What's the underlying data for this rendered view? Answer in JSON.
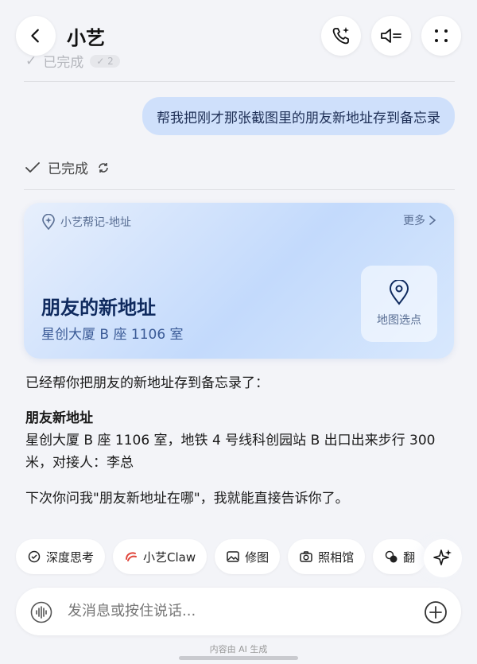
{
  "header": {
    "title": "小艺",
    "back_icon": "chevron-left-icon",
    "actions": [
      "phone-sparkle-icon",
      "speaker-icon",
      "more-dots-icon"
    ]
  },
  "previous_status": {
    "label": "已完成",
    "badge": "✓ 2"
  },
  "user_message": "帮我把刚才那张截图里的朋友新地址存到备忘录",
  "status": {
    "label": "已完成"
  },
  "card": {
    "source": "小艺帮记-地址",
    "more": "更多",
    "title": "朋友的新地址",
    "subtitle": "星创大厦 B 座 1106 室",
    "map_button": "地图选点"
  },
  "reply": {
    "intro": "已经帮你把朋友的新地址存到备忘录了：",
    "heading": "朋友新地址",
    "body_line1": "星创大厦 B 座 1106 室，地铁 4 号线科创园站 B 出口出来步行 300",
    "body_line2": "米，对接人：李总",
    "closing": "下次你问我\"朋友新地址在哪\"，我就能直接告诉你了。"
  },
  "chips": [
    {
      "label": "深度思考",
      "icon": "deep-think-icon"
    },
    {
      "label": "小艺Claw",
      "icon": "claw-icon"
    },
    {
      "label": "修图",
      "icon": "image-edit-icon"
    },
    {
      "label": "照相馆",
      "icon": "camera-icon"
    },
    {
      "label": "翻",
      "icon": "translate-icon"
    }
  ],
  "input": {
    "placeholder": "发消息或按住说话..."
  },
  "footer_note": "内容由 AI 生成",
  "colors": {
    "accent": "#cfe0fb",
    "card_title": "#0f2a5e",
    "background": "#f3f4f8"
  }
}
